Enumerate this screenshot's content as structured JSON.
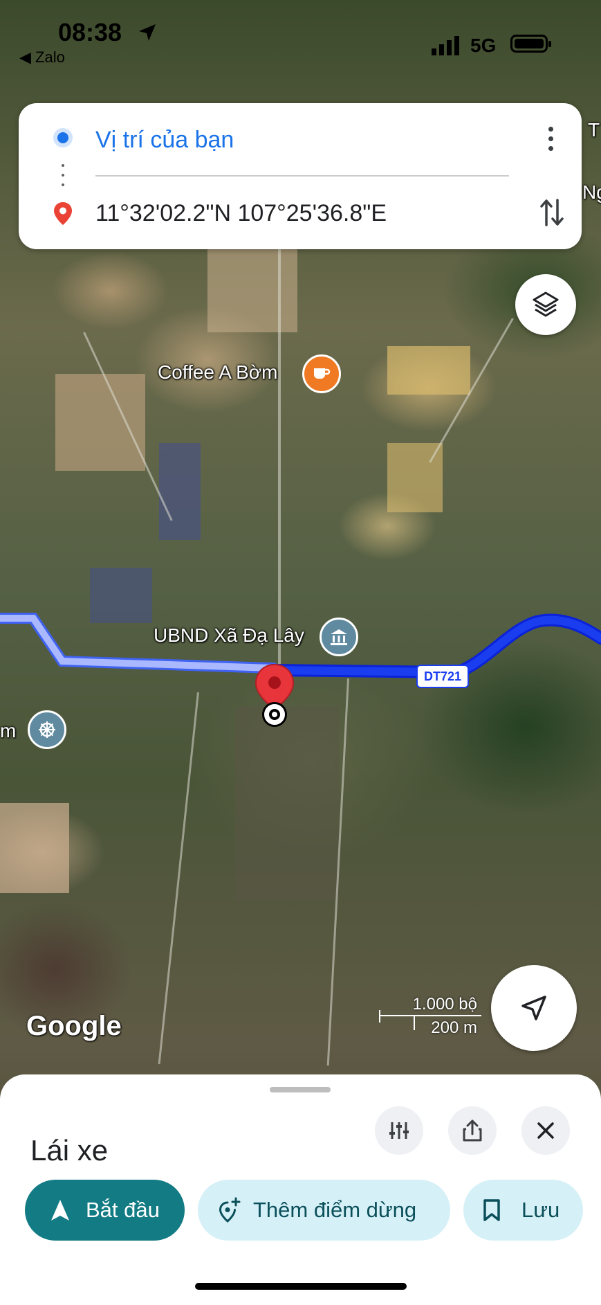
{
  "status_bar": {
    "time": "08:38",
    "back_app": "◀ Zalo",
    "network": "5G"
  },
  "directions": {
    "origin": "Vị trí của bạn",
    "destination": "11°32'02.2\"N 107°25'36.8\"E"
  },
  "map": {
    "pois": {
      "coffee": "Coffee A Bờm",
      "ubnd": "UBND Xã Đạ Lây",
      "left_edge": "m",
      "right_edge_1": "T",
      "right_edge_2": "Ng"
    },
    "road_label": "DT721",
    "scale_top": "1.000 bộ",
    "scale_bottom": "200 m",
    "attribution": "Google"
  },
  "sheet": {
    "mode": "Lái xe",
    "start": "Bắt đầu",
    "add_stop": "Thêm điểm dừng",
    "save": "Lưu"
  },
  "colors": {
    "route_active": "#1a3df0",
    "route_alt": "#a9b8ff",
    "primary_btn": "#137b84",
    "secondary_btn": "#d5f1f7"
  }
}
